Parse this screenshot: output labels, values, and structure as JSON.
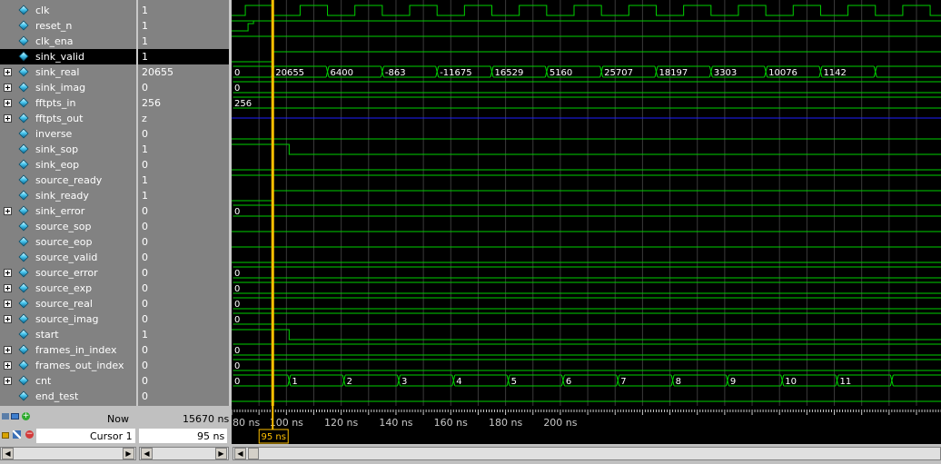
{
  "signals": [
    {
      "name": "clk",
      "value": "1",
      "bus": false
    },
    {
      "name": "reset_n",
      "value": "1",
      "bus": false
    },
    {
      "name": "clk_ena",
      "value": "1",
      "bus": false
    },
    {
      "name": "sink_valid",
      "value": "1",
      "bus": false,
      "selected": true
    },
    {
      "name": "sink_real",
      "value": "20655",
      "bus": true
    },
    {
      "name": "sink_imag",
      "value": "0",
      "bus": true
    },
    {
      "name": "fftpts_in",
      "value": "256",
      "bus": true
    },
    {
      "name": "fftpts_out",
      "value": "z",
      "bus": true
    },
    {
      "name": "inverse",
      "value": "0",
      "bus": false
    },
    {
      "name": "sink_sop",
      "value": "1",
      "bus": false
    },
    {
      "name": "sink_eop",
      "value": "0",
      "bus": false
    },
    {
      "name": "source_ready",
      "value": "1",
      "bus": false
    },
    {
      "name": "sink_ready",
      "value": "1",
      "bus": false
    },
    {
      "name": "sink_error",
      "value": "0",
      "bus": true
    },
    {
      "name": "source_sop",
      "value": "0",
      "bus": false
    },
    {
      "name": "source_eop",
      "value": "0",
      "bus": false
    },
    {
      "name": "source_valid",
      "value": "0",
      "bus": false
    },
    {
      "name": "source_error",
      "value": "0",
      "bus": true
    },
    {
      "name": "source_exp",
      "value": "0",
      "bus": true
    },
    {
      "name": "source_real",
      "value": "0",
      "bus": true
    },
    {
      "name": "source_imag",
      "value": "0",
      "bus": true
    },
    {
      "name": "start",
      "value": "1",
      "bus": false
    },
    {
      "name": "frames_in_index",
      "value": "0",
      "bus": true
    },
    {
      "name": "frames_out_index",
      "value": "0",
      "bus": true
    },
    {
      "name": "cnt",
      "value": "0",
      "bus": true
    },
    {
      "name": "end_test",
      "value": "0",
      "bus": false
    }
  ],
  "waves": {
    "sink_real_labels": [
      "0",
      "20655",
      "6400",
      "-863",
      "-11675",
      "16529",
      "5160",
      "25707",
      "18197",
      "3303",
      "10076",
      "1142"
    ],
    "sink_imag_label": "0",
    "fftpts_in_label": "256",
    "sink_error_label": "0",
    "source_error_label": "0",
    "source_exp_label": "0",
    "source_real_label": "0",
    "source_imag_label": "0",
    "frames_in_index_label": "0",
    "frames_out_index_label": "0",
    "cnt_labels": [
      "0",
      "1",
      "2",
      "3",
      "4",
      "5",
      "6",
      "7",
      "8",
      "9",
      "10",
      "11"
    ]
  },
  "timeline": {
    "now_label": "Now",
    "now_value": "15670 ns",
    "cursor_label": "Cursor 1",
    "cursor_value": "95 ns",
    "cursor_tag": "95 ns",
    "ticks": [
      "80 ns",
      "100 ns",
      "120 ns",
      "140 ns",
      "160 ns",
      "180 ns",
      "200 ns"
    ]
  },
  "colors": {
    "wave": "#00d000",
    "bus_z": "#2020ff",
    "cursor": "#ffc000",
    "grid": "#3a3a3a"
  }
}
